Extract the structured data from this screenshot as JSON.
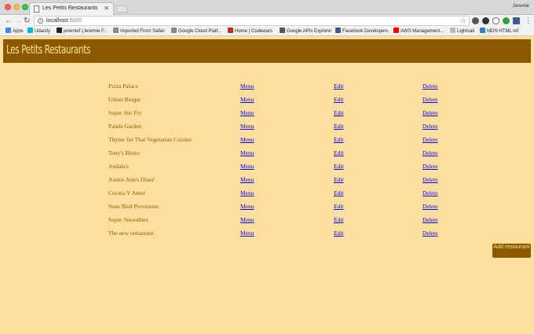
{
  "browser": {
    "tab_title": "Les Petits Restaurants",
    "profile_name": "Jeremie",
    "url_host": "localhost",
    "url_port": ":5000",
    "bookmarks": [
      {
        "label": "Apps",
        "icon": "apps-grid-icon",
        "color": "#4285f4"
      },
      {
        "label": "Udacity",
        "icon": "udacity-icon",
        "color": "#02b3e4"
      },
      {
        "label": "jeremief (Jeremie F...",
        "icon": "github-icon",
        "color": "#222222"
      },
      {
        "label": "Imported From Safari",
        "icon": "folder-icon",
        "color": "#8a8a8a"
      },
      {
        "label": "Google Cloud Platf...",
        "icon": "cloud-icon",
        "color": "#888888"
      },
      {
        "label": "Home | Codewars",
        "icon": "codewars-icon",
        "color": "#b1361e"
      },
      {
        "label": "Google APIs Explorer",
        "icon": "code-brackets-icon",
        "color": "#555555"
      },
      {
        "label": "Facebook Developers",
        "icon": "facebook-icon",
        "color": "#3b5998"
      },
      {
        "label": "AWS Management...",
        "icon": "aws-icon",
        "color": "#f90000"
      },
      {
        "label": "Lightsail",
        "icon": "document-icon",
        "color": "#bbbbbb"
      },
      {
        "label": "MDN HTML ref",
        "icon": "mdn-icon",
        "color": "#3b7bbf"
      }
    ]
  },
  "page": {
    "title": "Les Petits Restaurants",
    "menu_label": "Menu",
    "edit_label": "Edit",
    "delete_label": "Delete",
    "add_button_label": "Add restaurant",
    "restaurants": [
      "Pizza Palace",
      "Urban Burger",
      "Super Stir Fry",
      "Panda Garden",
      "Thyme for That Vegetarian Cuisine",
      "Tony's Bistro",
      "Andala's",
      "Auntie Ann's Diner'",
      "Cocina Y Amor",
      "State Bird Provisions",
      "Super Smoothies",
      "The new restaurant"
    ]
  },
  "colors": {
    "background": "#ffdf9e",
    "header_brown": "#8b5a00",
    "header_text": "#ffe08a",
    "link_blue": "#0000ee"
  }
}
